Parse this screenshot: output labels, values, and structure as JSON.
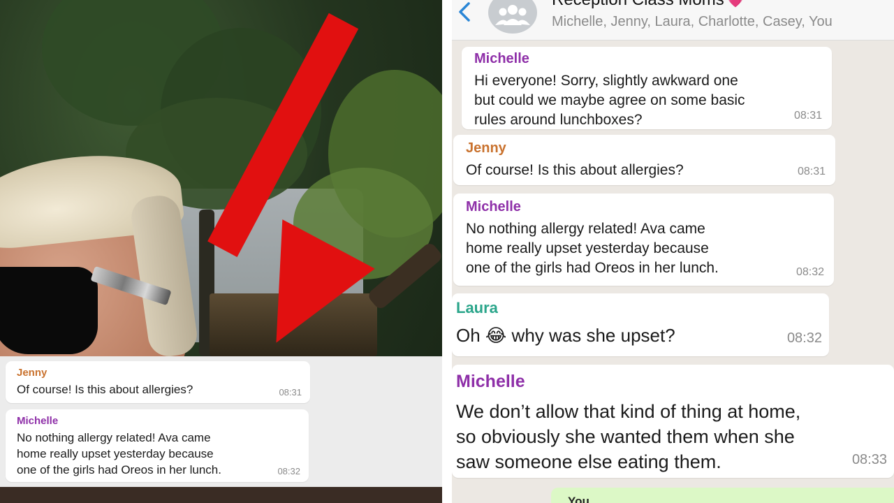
{
  "left_overlay": {
    "messages": [
      {
        "sender": "Jenny",
        "text": "Of course! Is this about allergies?",
        "time": "08:31"
      },
      {
        "sender": "Michelle",
        "lines": [
          "No nothing allergy related! Ava came",
          "home really upset yesterday because",
          "one of the girls had Oreos in her lunch."
        ],
        "time": "08:32"
      }
    ]
  },
  "chat": {
    "header": {
      "title": "Reception Class Moms",
      "title_emoji": "💗",
      "members": "Michelle, Jenny, Laura, Charlotte, Casey, You"
    },
    "messages": [
      {
        "sender": "Michelle",
        "lines": [
          "Hi everyone! Sorry, slightly awkward one",
          "but could we maybe agree on some basic",
          "rules around lunchboxes?"
        ],
        "time": "08:31"
      },
      {
        "sender": "Jenny",
        "text": "Of course! Is this about allergies?",
        "time": "08:31"
      },
      {
        "sender": "Michelle",
        "lines": [
          "No nothing allergy related! Ava came",
          "home really upset yesterday because",
          "one of the girls had Oreos in her lunch."
        ],
        "time": "08:32"
      },
      {
        "sender": "Laura",
        "text_before": "Oh",
        "emoji": "😂",
        "text_after": "why was she upset?",
        "time": "08:32"
      },
      {
        "sender": "Michelle",
        "lines": [
          "We don’t allow that kind of thing at home,",
          "so obviously she wanted them when she",
          "saw someone else eating them."
        ],
        "time": "08:33"
      }
    ],
    "outgoing_partial": {
      "sender": "You"
    }
  },
  "colors": {
    "michelle": "#8e2fa8",
    "jenny": "#c9722e",
    "laura": "#2aa58a",
    "arrow": "#e11010",
    "outgoing_bubble": "#dcf8c6"
  }
}
